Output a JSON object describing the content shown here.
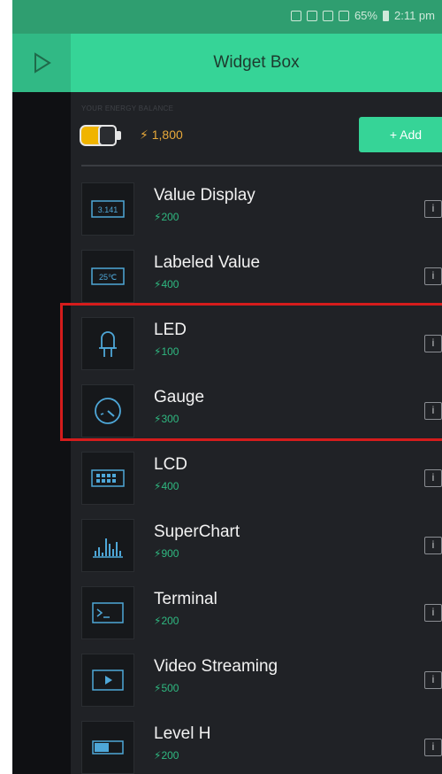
{
  "status_bar": {
    "battery_percent": "65%",
    "time": "2:11 pm"
  },
  "header": {
    "title": "Widget Box",
    "play_icon": "play-icon"
  },
  "energy": {
    "caption": "YOUR ENERGY BALANCE",
    "amount": "1,800",
    "add_label": "+ Add"
  },
  "widgets": [
    {
      "name": "Value Display",
      "cost": "200",
      "icon": "value-display-icon",
      "icon_text": "3.141"
    },
    {
      "name": "Labeled Value",
      "cost": "400",
      "icon": "labeled-value-icon",
      "icon_text": "25℃"
    },
    {
      "name": "LED",
      "cost": "100",
      "icon": "led-icon"
    },
    {
      "name": "Gauge",
      "cost": "300",
      "icon": "gauge-icon"
    },
    {
      "name": "LCD",
      "cost": "400",
      "icon": "lcd-icon"
    },
    {
      "name": "SuperChart",
      "cost": "900",
      "icon": "superchart-icon"
    },
    {
      "name": "Terminal",
      "cost": "200",
      "icon": "terminal-icon"
    },
    {
      "name": "Video Streaming",
      "cost": "500",
      "icon": "video-streaming-icon"
    },
    {
      "name": "Level H",
      "cost": "200",
      "icon": "level-h-icon"
    }
  ],
  "info_label": "i",
  "colors": {
    "accent": "#36d497",
    "accent_dark": "#31b985",
    "background": "#202226",
    "cost_text": "#2fb981",
    "energy_text": "#e8a93a",
    "highlight_border": "#d51c1c"
  }
}
